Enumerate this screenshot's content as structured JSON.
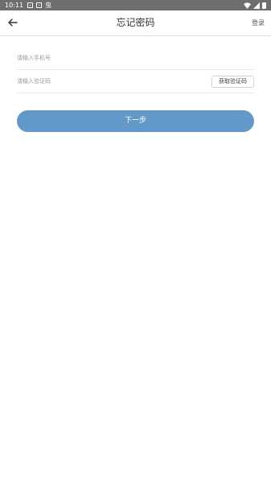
{
  "status_bar": {
    "time": "10:11",
    "bug_glyph": "虫"
  },
  "header": {
    "title": "忘记密码",
    "right_link": "登录"
  },
  "form": {
    "phone_placeholder": "请输入手机号",
    "code_placeholder": "请输入验证码",
    "get_code_label": "获取验证码",
    "next_label": "下一步"
  },
  "colors": {
    "accent": "#6399c9",
    "status_bar": "#6e6e6e"
  },
  "icons": {
    "back": "arrow-left-icon",
    "wifi": "wifi-icon",
    "signal": "signal-icon",
    "battery": "battery-icon"
  }
}
